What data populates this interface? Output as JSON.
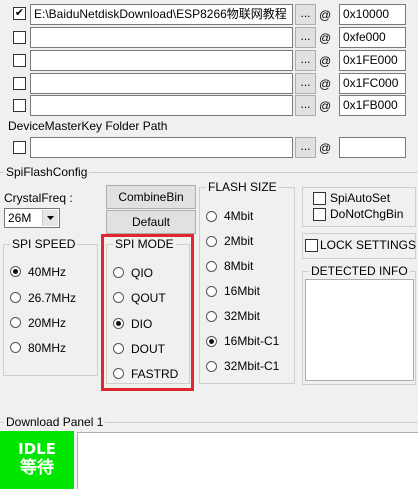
{
  "rows": [
    {
      "checked": true,
      "path": "E:\\BaiduNetdiskDownload\\ESP8266物联网教程",
      "address": "0x10000"
    },
    {
      "checked": false,
      "path": "",
      "address": "0xfe000"
    },
    {
      "checked": false,
      "path": "",
      "address": "0x1FE000"
    },
    {
      "checked": false,
      "path": "",
      "address": "0x1FC000"
    },
    {
      "checked": false,
      "path": "",
      "address": "0x1FB000"
    }
  ],
  "browse_label": "...",
  "at_symbol": "@",
  "check_mark": "✔",
  "device_key": {
    "label": "DeviceMasterKey Folder Path",
    "path": "",
    "address": ""
  },
  "spi_flash_config": {
    "title": "SpiFlashConfig",
    "crystal_label": "CrystalFreq :",
    "crystal_value": "26M",
    "combine_button": "CombineBin",
    "default_button": "Default",
    "spi_speed": {
      "title": "SPI SPEED",
      "options": [
        "40MHz",
        "26.7MHz",
        "20MHz",
        "80MHz"
      ],
      "selected": 0
    },
    "spi_mode": {
      "title": "SPI MODE",
      "options": [
        "QIO",
        "QOUT",
        "DIO",
        "DOUT",
        "FASTRD"
      ],
      "selected": 2
    },
    "flash_size": {
      "title": "FLASH SIZE",
      "options": [
        "4Mbit",
        "2Mbit",
        "8Mbit",
        "16Mbit",
        "32Mbit",
        "16Mbit-C1",
        "32Mbit-C1"
      ],
      "selected": 5
    },
    "spi_auto_set": "SpiAutoSet",
    "do_not_chg_bin": "DoNotChgBin",
    "lock_settings": "LOCK SETTINGS",
    "detected_info": "DETECTED INFO"
  },
  "download_panel": {
    "title": "Download Panel 1",
    "status_en": "IDLE",
    "status_cn": "等待"
  },
  "colors": {
    "highlight": "#e0262e",
    "idle_green": "#00e600",
    "background": "#f0f0f0"
  }
}
